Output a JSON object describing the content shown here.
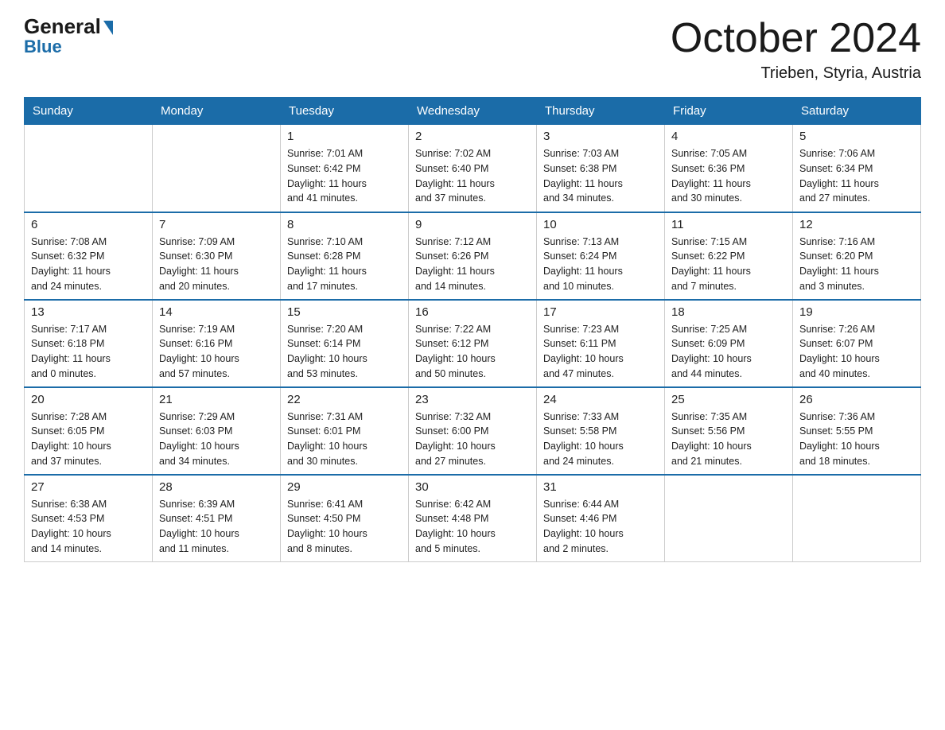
{
  "logo": {
    "general": "General",
    "blue": "Blue"
  },
  "title": "October 2024",
  "subtitle": "Trieben, Styria, Austria",
  "weekdays": [
    "Sunday",
    "Monday",
    "Tuesday",
    "Wednesday",
    "Thursday",
    "Friday",
    "Saturday"
  ],
  "weeks": [
    [
      {
        "day": "",
        "info": ""
      },
      {
        "day": "",
        "info": ""
      },
      {
        "day": "1",
        "info": "Sunrise: 7:01 AM\nSunset: 6:42 PM\nDaylight: 11 hours\nand 41 minutes."
      },
      {
        "day": "2",
        "info": "Sunrise: 7:02 AM\nSunset: 6:40 PM\nDaylight: 11 hours\nand 37 minutes."
      },
      {
        "day": "3",
        "info": "Sunrise: 7:03 AM\nSunset: 6:38 PM\nDaylight: 11 hours\nand 34 minutes."
      },
      {
        "day": "4",
        "info": "Sunrise: 7:05 AM\nSunset: 6:36 PM\nDaylight: 11 hours\nand 30 minutes."
      },
      {
        "day": "5",
        "info": "Sunrise: 7:06 AM\nSunset: 6:34 PM\nDaylight: 11 hours\nand 27 minutes."
      }
    ],
    [
      {
        "day": "6",
        "info": "Sunrise: 7:08 AM\nSunset: 6:32 PM\nDaylight: 11 hours\nand 24 minutes."
      },
      {
        "day": "7",
        "info": "Sunrise: 7:09 AM\nSunset: 6:30 PM\nDaylight: 11 hours\nand 20 minutes."
      },
      {
        "day": "8",
        "info": "Sunrise: 7:10 AM\nSunset: 6:28 PM\nDaylight: 11 hours\nand 17 minutes."
      },
      {
        "day": "9",
        "info": "Sunrise: 7:12 AM\nSunset: 6:26 PM\nDaylight: 11 hours\nand 14 minutes."
      },
      {
        "day": "10",
        "info": "Sunrise: 7:13 AM\nSunset: 6:24 PM\nDaylight: 11 hours\nand 10 minutes."
      },
      {
        "day": "11",
        "info": "Sunrise: 7:15 AM\nSunset: 6:22 PM\nDaylight: 11 hours\nand 7 minutes."
      },
      {
        "day": "12",
        "info": "Sunrise: 7:16 AM\nSunset: 6:20 PM\nDaylight: 11 hours\nand 3 minutes."
      }
    ],
    [
      {
        "day": "13",
        "info": "Sunrise: 7:17 AM\nSunset: 6:18 PM\nDaylight: 11 hours\nand 0 minutes."
      },
      {
        "day": "14",
        "info": "Sunrise: 7:19 AM\nSunset: 6:16 PM\nDaylight: 10 hours\nand 57 minutes."
      },
      {
        "day": "15",
        "info": "Sunrise: 7:20 AM\nSunset: 6:14 PM\nDaylight: 10 hours\nand 53 minutes."
      },
      {
        "day": "16",
        "info": "Sunrise: 7:22 AM\nSunset: 6:12 PM\nDaylight: 10 hours\nand 50 minutes."
      },
      {
        "day": "17",
        "info": "Sunrise: 7:23 AM\nSunset: 6:11 PM\nDaylight: 10 hours\nand 47 minutes."
      },
      {
        "day": "18",
        "info": "Sunrise: 7:25 AM\nSunset: 6:09 PM\nDaylight: 10 hours\nand 44 minutes."
      },
      {
        "day": "19",
        "info": "Sunrise: 7:26 AM\nSunset: 6:07 PM\nDaylight: 10 hours\nand 40 minutes."
      }
    ],
    [
      {
        "day": "20",
        "info": "Sunrise: 7:28 AM\nSunset: 6:05 PM\nDaylight: 10 hours\nand 37 minutes."
      },
      {
        "day": "21",
        "info": "Sunrise: 7:29 AM\nSunset: 6:03 PM\nDaylight: 10 hours\nand 34 minutes."
      },
      {
        "day": "22",
        "info": "Sunrise: 7:31 AM\nSunset: 6:01 PM\nDaylight: 10 hours\nand 30 minutes."
      },
      {
        "day": "23",
        "info": "Sunrise: 7:32 AM\nSunset: 6:00 PM\nDaylight: 10 hours\nand 27 minutes."
      },
      {
        "day": "24",
        "info": "Sunrise: 7:33 AM\nSunset: 5:58 PM\nDaylight: 10 hours\nand 24 minutes."
      },
      {
        "day": "25",
        "info": "Sunrise: 7:35 AM\nSunset: 5:56 PM\nDaylight: 10 hours\nand 21 minutes."
      },
      {
        "day": "26",
        "info": "Sunrise: 7:36 AM\nSunset: 5:55 PM\nDaylight: 10 hours\nand 18 minutes."
      }
    ],
    [
      {
        "day": "27",
        "info": "Sunrise: 6:38 AM\nSunset: 4:53 PM\nDaylight: 10 hours\nand 14 minutes."
      },
      {
        "day": "28",
        "info": "Sunrise: 6:39 AM\nSunset: 4:51 PM\nDaylight: 10 hours\nand 11 minutes."
      },
      {
        "day": "29",
        "info": "Sunrise: 6:41 AM\nSunset: 4:50 PM\nDaylight: 10 hours\nand 8 minutes."
      },
      {
        "day": "30",
        "info": "Sunrise: 6:42 AM\nSunset: 4:48 PM\nDaylight: 10 hours\nand 5 minutes."
      },
      {
        "day": "31",
        "info": "Sunrise: 6:44 AM\nSunset: 4:46 PM\nDaylight: 10 hours\nand 2 minutes."
      },
      {
        "day": "",
        "info": ""
      },
      {
        "day": "",
        "info": ""
      }
    ]
  ]
}
